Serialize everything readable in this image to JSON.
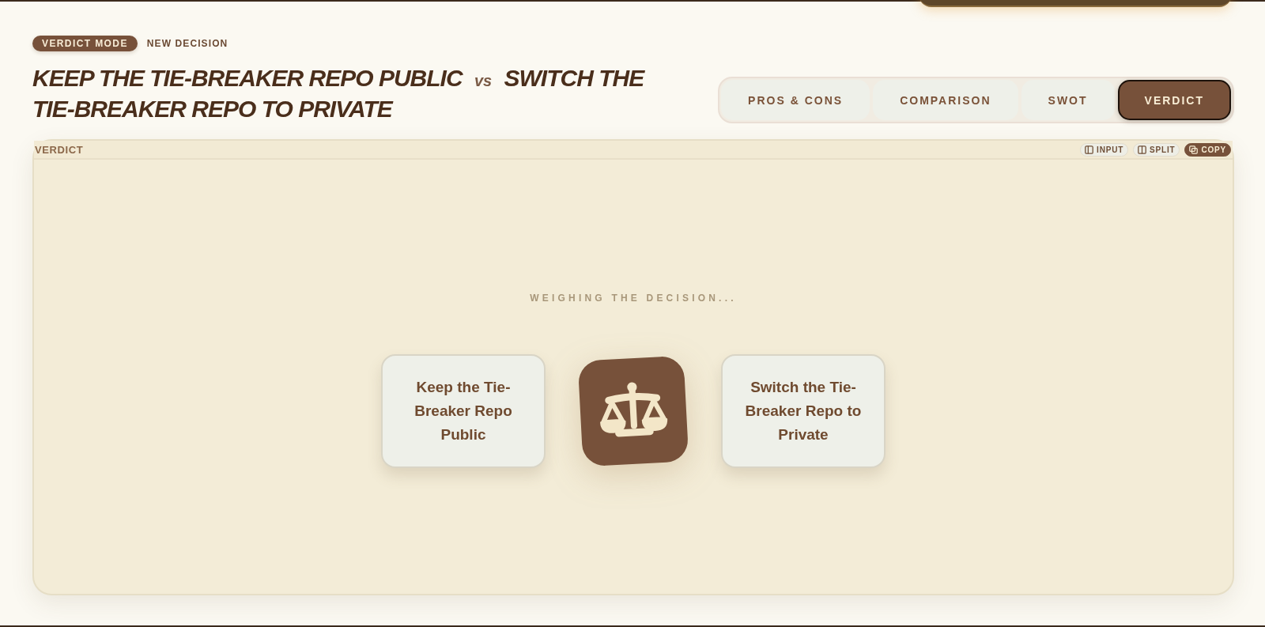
{
  "header": {
    "badge": "VERDICT MODE",
    "new_decision": "NEW DECISION",
    "title": {
      "option_a": "KEEP THE TIE-BREAKER REPO PUBLIC",
      "separator": "vs",
      "option_b": "SWITCH THE TIE-BREAKER REPO TO PRIVATE"
    }
  },
  "tabs": [
    {
      "label": "PROS & CONS",
      "selected": false
    },
    {
      "label": "COMPARISON",
      "selected": false
    },
    {
      "label": "SWOT",
      "selected": false
    },
    {
      "label": "VERDICT",
      "selected": true
    }
  ],
  "panel": {
    "title": "VERDICT",
    "actions": [
      {
        "label": "INPUT",
        "kind": "input"
      },
      {
        "label": "SPLIT",
        "kind": "split"
      },
      {
        "label": "COPY",
        "kind": "copy"
      }
    ],
    "status": "WEIGHING THE DECISION...",
    "options": [
      "Keep the Tie-Breaker Repo Public",
      "Switch the Tie-Breaker Repo to Private"
    ]
  }
}
